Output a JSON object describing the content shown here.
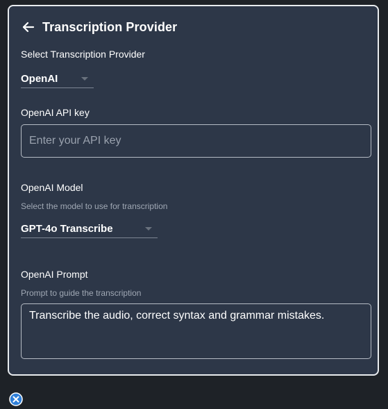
{
  "header": {
    "title": "Transcription Provider"
  },
  "provider": {
    "label": "Select Transcription Provider",
    "selected": "OpenAI"
  },
  "api_key": {
    "label": "OpenAI API key",
    "placeholder": "Enter your API key",
    "value": ""
  },
  "model": {
    "label": "OpenAI Model",
    "description": "Select the model to use for transcription",
    "selected": "GPT-4o Transcribe"
  },
  "prompt": {
    "label": "OpenAI Prompt",
    "description": "Prompt to guide the transcription",
    "value": "Transcribe the audio, correct syntax and grammar mistakes."
  },
  "icons": {
    "back": "arrow-left-icon",
    "close": "close-circle-icon"
  },
  "colors": {
    "panel_bg": "#2d3748",
    "page_bg": "#1e2227",
    "close_accent": "#2f7fd8"
  }
}
